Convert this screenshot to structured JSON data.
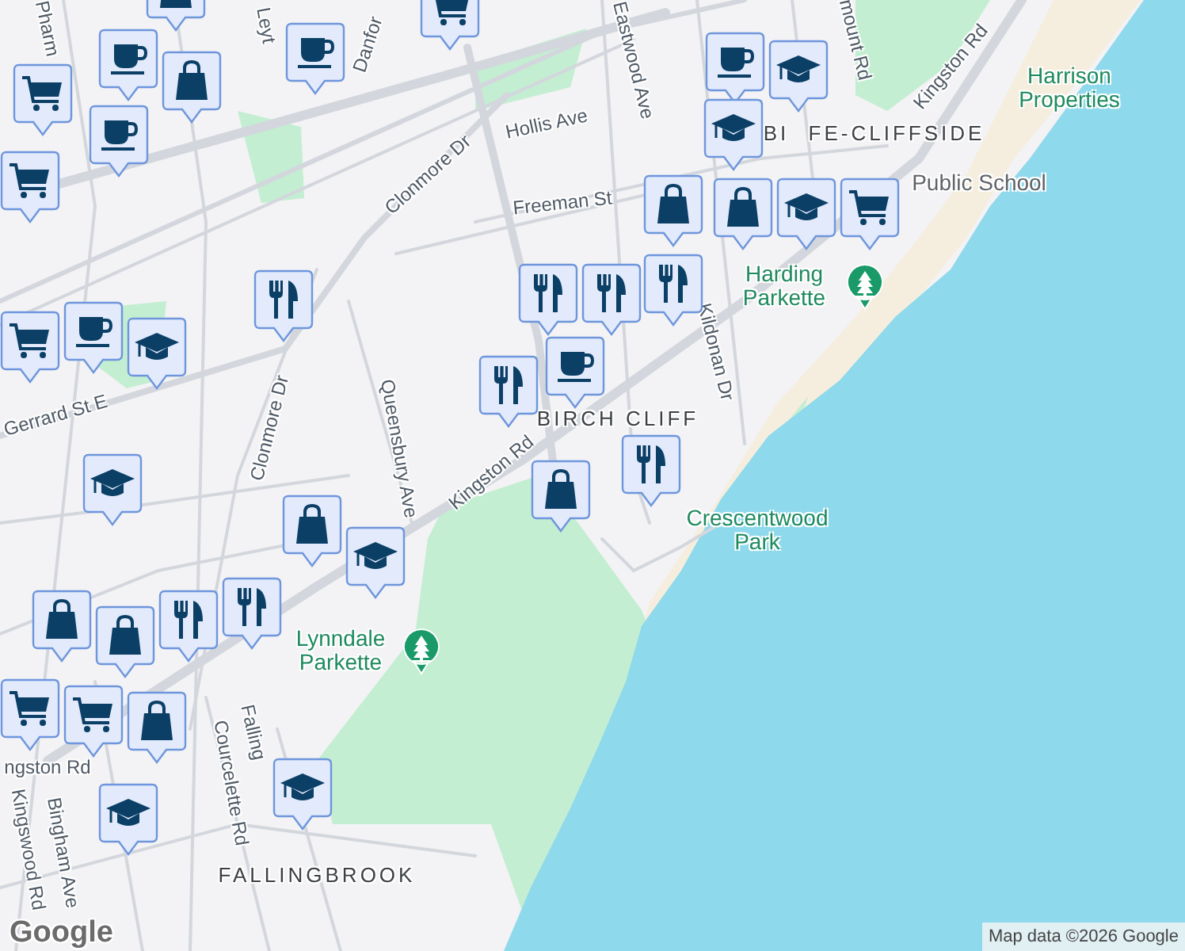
{
  "map": {
    "labels": [
      {
        "text": "Pharm",
        "kind": "street"
      },
      {
        "text": "Leyt",
        "kind": "street"
      },
      {
        "text": "Danfor",
        "kind": "street"
      },
      {
        "text": "Hollis Ave",
        "kind": "street"
      },
      {
        "text": "Clonmore Dr",
        "kind": "street"
      },
      {
        "text": "Eastwood Ave",
        "kind": "street"
      },
      {
        "text": "Freeman St",
        "kind": "street"
      },
      {
        "text": "mount Rd",
        "kind": "street"
      },
      {
        "text": "Kingston Rd",
        "kind": "street"
      },
      {
        "text": "Harrison Properties",
        "kind": "park"
      },
      {
        "text": "BI",
        "kind": "area"
      },
      {
        "text": "FE-CLIFFSIDE",
        "kind": "area"
      },
      {
        "text": "Public School",
        "kind": "poi"
      },
      {
        "text": "Harding Parkette",
        "kind": "park_pin"
      },
      {
        "text": "Kildonan Dr",
        "kind": "street"
      },
      {
        "text": "Gerrard St E",
        "kind": "street"
      },
      {
        "text": "Clonmore Dr",
        "kind": "street"
      },
      {
        "text": "Queensbury Ave",
        "kind": "street"
      },
      {
        "text": "Kingston Rd",
        "kind": "street"
      },
      {
        "text": "BIRCH CLIFF",
        "kind": "area"
      },
      {
        "text": "Crescentwood Park",
        "kind": "park"
      },
      {
        "text": "Lynndale Parkette",
        "kind": "park_pin"
      },
      {
        "text": "Falling",
        "kind": "street"
      },
      {
        "text": "Courcelette Rd",
        "kind": "street"
      },
      {
        "text": "ngston Rd",
        "kind": "street"
      },
      {
        "text": "Kingswood Rd",
        "kind": "street"
      },
      {
        "text": "Bingham Ave",
        "kind": "street"
      },
      {
        "text": "FALLINGBROOK",
        "kind": "area"
      }
    ],
    "markers": [
      {
        "kind": "shopping"
      },
      {
        "kind": "grocery"
      },
      {
        "kind": "shopping"
      },
      {
        "kind": "cafe"
      },
      {
        "kind": "grocery"
      },
      {
        "kind": "cafe"
      },
      {
        "kind": "cafe"
      },
      {
        "kind": "grocery"
      },
      {
        "kind": "restaurant"
      },
      {
        "kind": "grocery"
      },
      {
        "kind": "cafe"
      },
      {
        "kind": "school"
      },
      {
        "kind": "restaurant"
      },
      {
        "kind": "restaurant"
      },
      {
        "kind": "cafe"
      },
      {
        "kind": "restaurant"
      },
      {
        "kind": "shopping"
      },
      {
        "kind": "restaurant"
      },
      {
        "kind": "shopping"
      },
      {
        "kind": "school"
      },
      {
        "kind": "restaurant"
      },
      {
        "kind": "cafe"
      },
      {
        "kind": "school"
      },
      {
        "kind": "school"
      },
      {
        "kind": "grocery"
      },
      {
        "kind": "shopping"
      },
      {
        "kind": "school"
      },
      {
        "kind": "shopping"
      },
      {
        "kind": "school"
      },
      {
        "kind": "restaurant"
      },
      {
        "kind": "restaurant"
      },
      {
        "kind": "shopping"
      },
      {
        "kind": "shopping"
      },
      {
        "kind": "grocery"
      },
      {
        "kind": "grocery"
      },
      {
        "kind": "shopping"
      },
      {
        "kind": "school"
      },
      {
        "kind": "school"
      }
    ],
    "logo": "Google",
    "attribution": "Map data ©2026 Google"
  }
}
